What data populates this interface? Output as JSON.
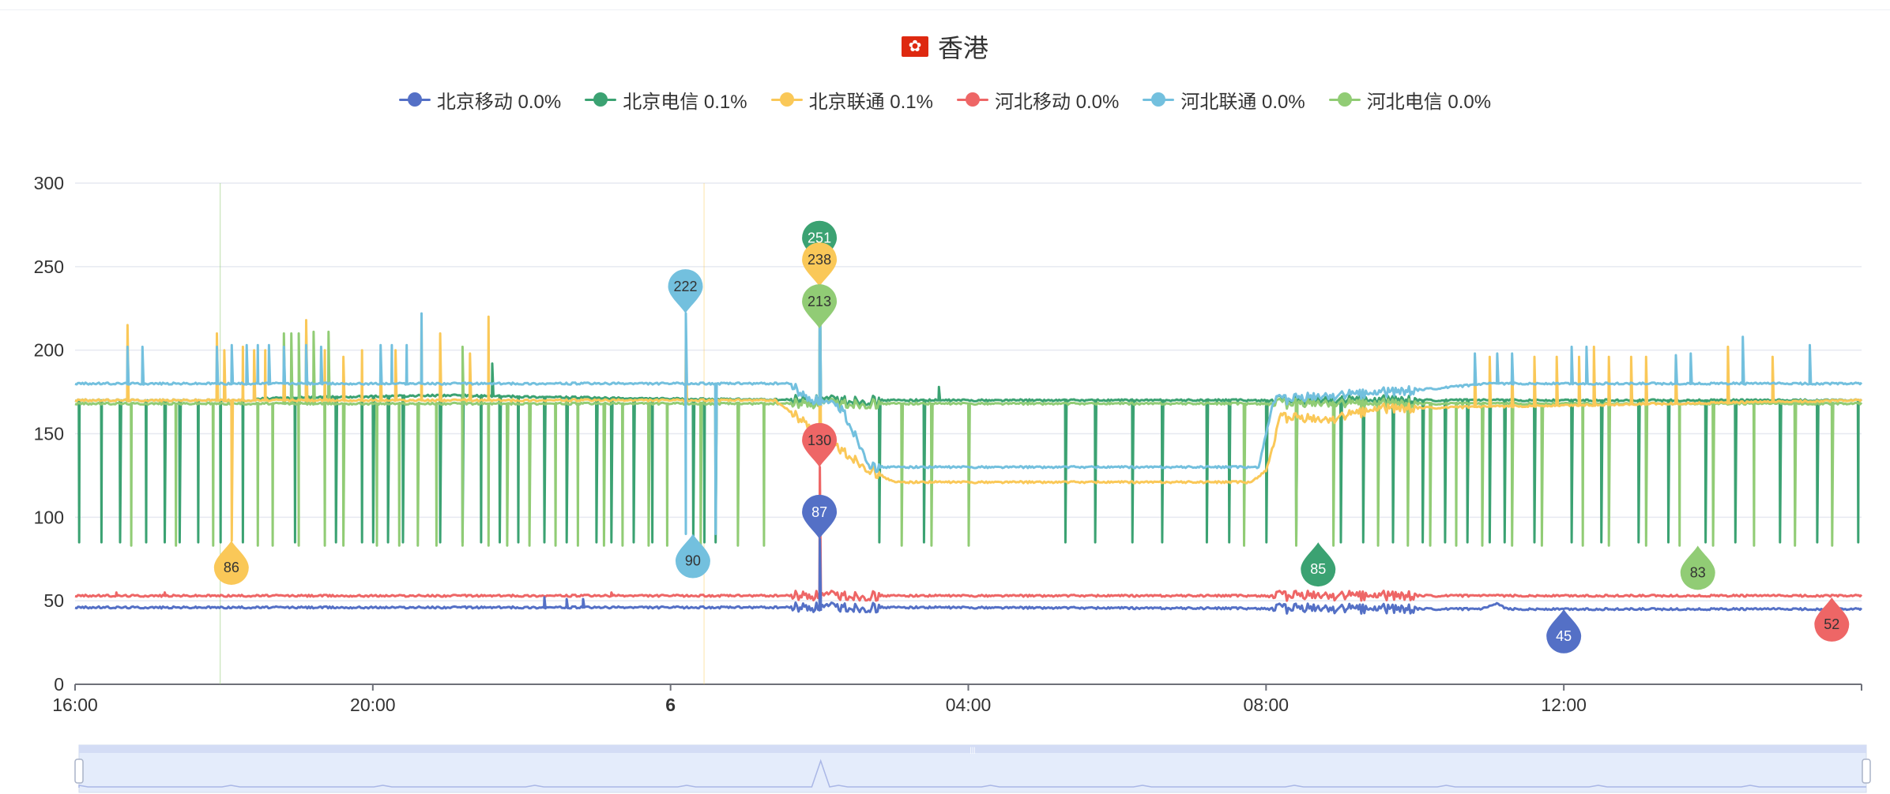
{
  "title": "香港",
  "flag_icon": "hong-kong-flag-icon",
  "legend": [
    {
      "label": "北京移动 0.0%",
      "color": "#5470c6"
    },
    {
      "label": "北京电信 0.1%",
      "color": "#3ba272"
    },
    {
      "label": "北京联通 0.1%",
      "color": "#fac858"
    },
    {
      "label": "河北移动 0.0%",
      "color": "#ee6666"
    },
    {
      "label": "河北联通 0.0%",
      "color": "#73c0de"
    },
    {
      "label": "河北电信 0.0%",
      "color": "#91cc75"
    }
  ],
  "chart_data": {
    "type": "line",
    "ylim": [
      0,
      300
    ],
    "y_ticks": [
      "0",
      "50",
      "100",
      "150",
      "200",
      "250",
      "300"
    ],
    "x_ticks": [
      {
        "label": "20:00",
        "t": "20:00",
        "bold": false
      },
      {
        "label": "6",
        "t": "00:00",
        "bold": true
      },
      {
        "label": "04:00",
        "t": "04:00",
        "bold": false
      },
      {
        "label": "08:00",
        "t": "08:00",
        "bold": false
      },
      {
        "label": "12:00",
        "t": "12:00",
        "bold": false
      },
      {
        "label": "16:00",
        "t": "16:00",
        "bold": false
      }
    ],
    "x_range": [
      "16:00",
      "16:00 next day"
    ],
    "grid": true,
    "legend_position": "top-center",
    "series": [
      {
        "name": "北京移动",
        "color": "#5470c6",
        "base": [
          [
            0,
            46
          ],
          [
            9.7,
            46
          ],
          [
            10.7,
            46
          ],
          [
            11.4,
            46
          ],
          [
            18.9,
            45
          ],
          [
            19.1,
            48
          ],
          [
            19.25,
            45
          ],
          [
            24,
            45
          ]
        ],
        "drops": [],
        "spikes": [
          [
            6.3,
            52
          ],
          [
            6.6,
            51
          ],
          [
            6.82,
            51
          ],
          [
            10.0,
            87
          ]
        ]
      },
      {
        "name": "北京电信",
        "color": "#3ba272",
        "base": [
          [
            0,
            170
          ],
          [
            2.4,
            170
          ],
          [
            2.5,
            171
          ],
          [
            3.5,
            172
          ],
          [
            5,
            173
          ],
          [
            7.5,
            171
          ],
          [
            10.2,
            170
          ],
          [
            12,
            170
          ],
          [
            16,
            170
          ],
          [
            24,
            170
          ]
        ],
        "drops": [
          0.05,
          0.35,
          0.6,
          0.95,
          1.2,
          1.4,
          1.65,
          1.95,
          2.25,
          2.95,
          3.5,
          3.85,
          4.0,
          4.2,
          4.4,
          4.9,
          5.2,
          5.45,
          5.7,
          5.95,
          6.3,
          6.6,
          7.0,
          7.2,
          7.5,
          7.75,
          8.3,
          8.45,
          8.6,
          10.8,
          11.4,
          13.3,
          13.7,
          14.2,
          14.6,
          15.2,
          15.5,
          16.0,
          16.4,
          17.0,
          17.3,
          17.7,
          18.1,
          18.4,
          18.7,
          19.0,
          19.2,
          19.6,
          20.1,
          20.5,
          21.0,
          21.4,
          21.9,
          22.3,
          22.9,
          23.4,
          23.95
        ],
        "dropTo": 85,
        "spikes": [
          [
            5.6,
            192
          ],
          [
            11.6,
            178
          ],
          [
            10.0,
            251
          ]
        ]
      },
      {
        "name": "北京联通",
        "color": "#fac858",
        "base": [
          [
            0,
            170
          ],
          [
            9.4,
            170
          ],
          [
            9.7,
            160
          ],
          [
            10.0,
            150
          ],
          [
            10.3,
            140
          ],
          [
            10.7,
            128
          ],
          [
            11.0,
            121
          ],
          [
            15.8,
            121
          ],
          [
            16.0,
            128
          ],
          [
            16.2,
            160
          ],
          [
            16.8,
            158
          ],
          [
            17.5,
            165
          ],
          [
            24,
            170
          ]
        ],
        "drops": [
          2.1
        ],
        "dropTo": 86,
        "spikes": [
          [
            0.7,
            215
          ],
          [
            1.9,
            210
          ],
          [
            2.0,
            200
          ],
          [
            2.25,
            202
          ],
          [
            2.4,
            200
          ],
          [
            2.55,
            200
          ],
          [
            2.8,
            200
          ],
          [
            3.1,
            218
          ],
          [
            3.35,
            200
          ],
          [
            3.6,
            196
          ],
          [
            3.85,
            200
          ],
          [
            4.1,
            198
          ],
          [
            4.3,
            200
          ],
          [
            4.65,
            221
          ],
          [
            4.9,
            210
          ],
          [
            5.3,
            198
          ],
          [
            5.55,
            220
          ],
          [
            8.2,
            205
          ],
          [
            10.0,
            238
          ],
          [
            18.8,
            196
          ],
          [
            19.0,
            196
          ],
          [
            19.3,
            195
          ],
          [
            19.6,
            196
          ],
          [
            19.9,
            196
          ],
          [
            20.2,
            196
          ],
          [
            20.4,
            202
          ],
          [
            20.6,
            196
          ],
          [
            20.9,
            196
          ],
          [
            21.1,
            196
          ],
          [
            21.5,
            196
          ],
          [
            22.2,
            202
          ],
          [
            22.8,
            196
          ]
        ]
      },
      {
        "name": "河北移动",
        "color": "#ee6666",
        "base": [
          [
            0,
            53
          ],
          [
            24,
            53
          ]
        ],
        "drops": [],
        "spikes": [
          [
            0.55,
            55
          ],
          [
            1.2,
            55
          ],
          [
            7.2,
            55
          ],
          [
            10.0,
            130
          ]
        ]
      },
      {
        "name": "河北联通",
        "color": "#73c0de",
        "base": [
          [
            0,
            180
          ],
          [
            9.6,
            180
          ],
          [
            9.8,
            172
          ],
          [
            10.3,
            165
          ],
          [
            10.7,
            130
          ],
          [
            15.9,
            130
          ],
          [
            16.1,
            170
          ],
          [
            17.0,
            173
          ],
          [
            18.0,
            176
          ],
          [
            19.0,
            180
          ],
          [
            24,
            180
          ]
        ],
        "drops": [
          8.2,
          8.6
        ],
        "dropTo": 90,
        "spikes": [
          [
            0.7,
            202
          ],
          [
            0.9,
            202
          ],
          [
            1.9,
            202
          ],
          [
            2.1,
            203
          ],
          [
            2.3,
            203
          ],
          [
            2.45,
            203
          ],
          [
            2.6,
            203
          ],
          [
            2.8,
            202
          ],
          [
            3.1,
            203
          ],
          [
            3.3,
            202
          ],
          [
            4.1,
            203
          ],
          [
            4.25,
            203
          ],
          [
            4.45,
            203
          ],
          [
            4.65,
            222
          ],
          [
            8.2,
            222
          ],
          [
            10.0,
            240
          ],
          [
            18.8,
            198
          ],
          [
            19.1,
            198
          ],
          [
            19.3,
            198
          ],
          [
            20.1,
            202
          ],
          [
            20.3,
            202
          ],
          [
            21.5,
            197
          ],
          [
            21.7,
            198
          ],
          [
            22.4,
            208
          ],
          [
            23.3,
            203
          ]
        ]
      },
      {
        "name": "河北电信",
        "color": "#91cc75",
        "base": [
          [
            0,
            168
          ],
          [
            9.5,
            168
          ],
          [
            10.7,
            168
          ],
          [
            24,
            168
          ]
        ],
        "drops": [
          0.75,
          1.35,
          1.85,
          2.45,
          2.65,
          3.0,
          3.35,
          3.6,
          4.05,
          4.35,
          4.6,
          4.85,
          5.2,
          5.55,
          5.8,
          6.1,
          6.45,
          6.75,
          7.1,
          7.35,
          7.7,
          7.95,
          8.4,
          8.9,
          9.25,
          11.1,
          11.5,
          12.0,
          15.7,
          16.4,
          16.9,
          17.5,
          17.9,
          18.2,
          18.55,
          18.9,
          19.3,
          19.7,
          20.25,
          20.6,
          21.1,
          21.55,
          22.0,
          22.55,
          23.1,
          23.6
        ],
        "dropTo": 83,
        "spikes": [
          [
            5.2,
            202
          ],
          [
            10.0,
            213
          ],
          [
            2.8,
            210
          ],
          [
            2.9,
            210
          ],
          [
            3.0,
            210
          ],
          [
            3.1,
            211
          ],
          [
            3.2,
            211
          ],
          [
            3.4,
            211
          ]
        ]
      }
    ],
    "markers": [
      {
        "series": "北京联通",
        "label": "86",
        "x": 2.1,
        "y": 86,
        "dir": "up",
        "color": "#fac858",
        "textColor": "#333"
      },
      {
        "series": "河北联通",
        "label": "222",
        "x": 8.2,
        "y": 222,
        "dir": "down",
        "color": "#73c0de",
        "textColor": "#333"
      },
      {
        "series": "河北联通",
        "label": "90",
        "x": 8.3,
        "y": 90,
        "dir": "up",
        "color": "#73c0de",
        "textColor": "#333"
      },
      {
        "series": "北京电信",
        "label": "251",
        "x": 10.0,
        "y": 251,
        "dir": "down",
        "color": "#3ba272",
        "textColor": "#fff"
      },
      {
        "series": "北京联通",
        "label": "238",
        "x": 10.0,
        "y": 238,
        "dir": "down",
        "color": "#fac858",
        "textColor": "#333"
      },
      {
        "series": "河北电信",
        "label": "213",
        "x": 10.0,
        "y": 213,
        "dir": "down",
        "color": "#91cc75",
        "textColor": "#333"
      },
      {
        "series": "河北移动",
        "label": "130",
        "x": 10.0,
        "y": 130,
        "dir": "down",
        "color": "#ee6666",
        "textColor": "#333"
      },
      {
        "series": "北京移动",
        "label": "87",
        "x": 10.0,
        "y": 87,
        "dir": "down",
        "color": "#5470c6",
        "textColor": "#fff"
      },
      {
        "series": "北京电信",
        "label": "85",
        "x": 16.7,
        "y": 85,
        "dir": "up",
        "color": "#3ba272",
        "textColor": "#fff"
      },
      {
        "series": "北京移动",
        "label": "45",
        "x": 20.0,
        "y": 45,
        "dir": "up",
        "color": "#5470c6",
        "textColor": "#fff"
      },
      {
        "series": "河北电信",
        "label": "83",
        "x": 21.8,
        "y": 83,
        "dir": "up",
        "color": "#91cc75",
        "textColor": "#333"
      },
      {
        "series": "河北移动",
        "label": "52",
        "x": 23.6,
        "y": 52,
        "dir": "up",
        "color": "#ee6666",
        "textColor": "#333"
      }
    ],
    "datazoom_handle_label": "|||"
  }
}
